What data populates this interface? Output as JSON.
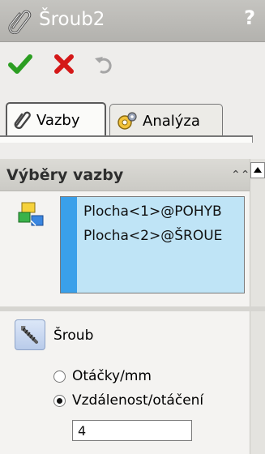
{
  "title_bar": {
    "title": "Šroub2",
    "help": "?",
    "icon": "paperclip-icon"
  },
  "actions": [
    {
      "name": "ok-button",
      "icon": "check-icon",
      "color": "#2c9e22"
    },
    {
      "name": "cancel-button",
      "icon": "x-icon",
      "color": "#d41818"
    },
    {
      "name": "undo-button",
      "icon": "undo-icon",
      "color": "#9a9a9a"
    }
  ],
  "tabs": [
    {
      "label": "Vazby",
      "icon": "paperclip-icon",
      "active": true
    },
    {
      "label": "Analýza",
      "icon": "gear-analysis-icon",
      "active": false
    }
  ],
  "selections": {
    "header": "Výběry vazby",
    "items": [
      "Plocha<1>@POHYB",
      "Plocha<2>@ŠROUE"
    ],
    "highlight_color": "#bfe4f6"
  },
  "screw": {
    "label": "Šroub",
    "options": [
      {
        "label": "Otáčky/mm",
        "selected": false
      },
      {
        "label": "Vzdálenost/otáčení",
        "selected": true
      }
    ],
    "value": "4"
  }
}
